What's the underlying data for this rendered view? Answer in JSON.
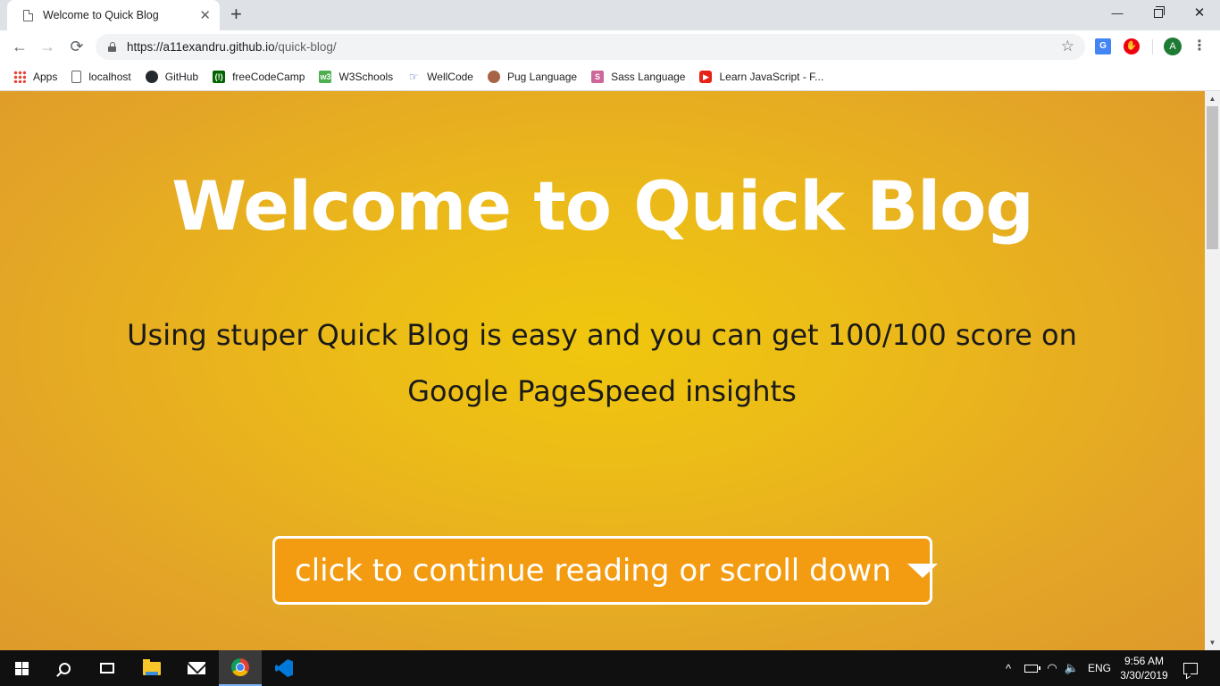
{
  "browser": {
    "tab": {
      "title": "Welcome to Quick Blog",
      "close": "✕"
    },
    "new_tab": "+",
    "window_controls": {
      "minimize": "—",
      "close": "✕"
    },
    "nav": {
      "back": "←",
      "forward": "→",
      "reload": "⟳"
    },
    "address": {
      "scheme_host": "https://a11exandru.github.io",
      "path": "/quick-blog/"
    },
    "bookmark_star": "☆",
    "extensions": [
      {
        "icon": "google-translate-icon",
        "glyph": "G"
      },
      {
        "icon": "adblock-icon",
        "glyph": "✋"
      }
    ],
    "profile_initial": "A",
    "menu": "⋮"
  },
  "bookmarks": [
    {
      "label": "Apps",
      "icon": "apps-grid-icon"
    },
    {
      "label": "localhost",
      "icon": "page-icon"
    },
    {
      "label": "GitHub",
      "icon": "github-icon",
      "glyph": ""
    },
    {
      "label": "freeCodeCamp",
      "icon": "freecodecamp-icon",
      "glyph": "(!)"
    },
    {
      "label": "W3Schools",
      "icon": "w3schools-icon",
      "glyph": "w3"
    },
    {
      "label": "WellCode",
      "icon": "wellcode-icon",
      "glyph": "☞"
    },
    {
      "label": "Pug Language",
      "icon": "pug-icon",
      "glyph": ""
    },
    {
      "label": "Sass Language",
      "icon": "sass-icon",
      "glyph": "S"
    },
    {
      "label": "Learn JavaScript - F...",
      "icon": "youtube-icon",
      "glyph": "▶"
    }
  ],
  "page": {
    "title": "Welcome to Quick Blog",
    "subtitle": "Using stuper Quick Blog is easy and you can get 100/100 score on Google PageSpeed insights",
    "cta_label": "click to continue reading or scroll down",
    "colors": {
      "background": "#ebb91a",
      "button": "#f39c12",
      "title": "#ffffff"
    }
  },
  "scrollbar": {
    "up": "▲",
    "down": "▼"
  },
  "taskbar": {
    "apps": [
      "start",
      "search",
      "task-view",
      "file-explorer",
      "mail",
      "chrome",
      "vscode"
    ],
    "tray": {
      "chevron": "^",
      "wifi": "◠",
      "volume": "🔈",
      "language": "ENG",
      "time": "9:56 AM",
      "date": "3/30/2019"
    }
  }
}
